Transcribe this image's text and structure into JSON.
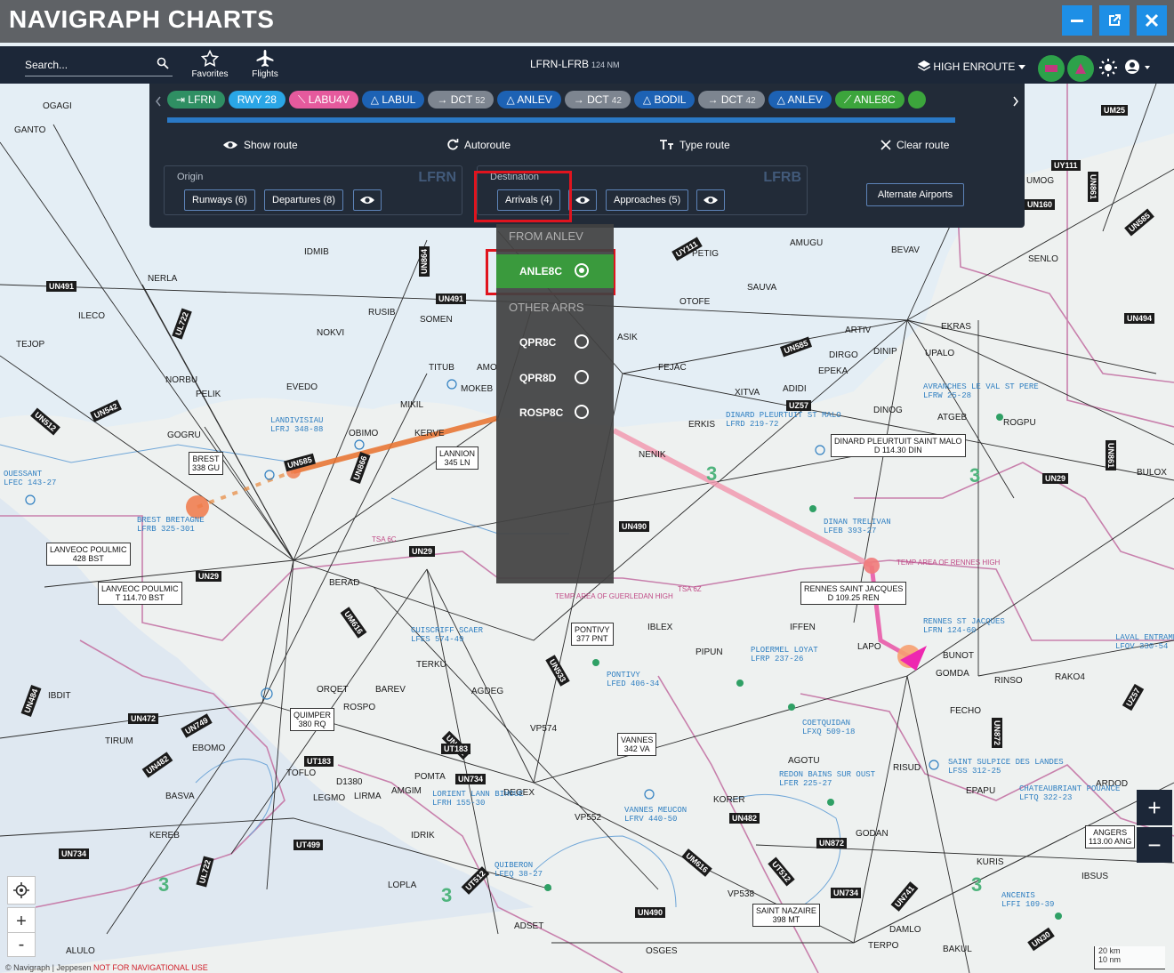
{
  "window": {
    "title": "NAVIGRAPH CHARTS",
    "controls": [
      "minimize",
      "popout",
      "close"
    ]
  },
  "toolbar": {
    "search_placeholder": "Search...",
    "favorites_label": "Favorites",
    "flights_label": "Flights",
    "route": "LFRN-LFRB",
    "distance": "124 NM",
    "layer": "HIGH ENROUTE"
  },
  "route_panel": {
    "chips": [
      {
        "label": "LFRN",
        "kind": "airport",
        "color": "#2f8f63"
      },
      {
        "label": "RWY 28",
        "kind": "runway",
        "color": "#2aa6e6"
      },
      {
        "label": "LABU4V",
        "kind": "sid",
        "color": "#e55a9d"
      },
      {
        "label": "LABUL",
        "kind": "fix",
        "color": "#1d62b4"
      },
      {
        "label": "DCT",
        "num": "52",
        "kind": "direct",
        "color": "#7d8590"
      },
      {
        "label": "ANLEV",
        "kind": "fix",
        "color": "#1d62b4"
      },
      {
        "label": "DCT",
        "num": "42",
        "kind": "direct",
        "color": "#7d8590"
      },
      {
        "label": "BODIL",
        "kind": "fix",
        "color": "#1d62b4"
      },
      {
        "label": "DCT",
        "num": "42",
        "kind": "direct",
        "color": "#7d8590"
      },
      {
        "label": "ANLEV",
        "kind": "fix",
        "color": "#1d62b4"
      },
      {
        "label": "ANLE8C",
        "kind": "star",
        "color": "#3ca53c"
      }
    ],
    "show_route": "Show route",
    "autoroute": "Autoroute",
    "type_route": "Type route",
    "clear_route": "Clear route",
    "origin": {
      "caption": "Origin",
      "icao": "LFRN",
      "runways": "Runways (6)",
      "departures": "Departures (8)"
    },
    "destination": {
      "caption": "Destination",
      "icao": "LFRB",
      "arrivals": "Arrivals (4)",
      "approaches": "Approaches (5)"
    },
    "alternate": "Alternate Airports"
  },
  "arrivals_dropdown": {
    "group_from": "FROM ANLEV",
    "selected": "ANLE8C",
    "group_other": "OTHER ARRS",
    "others": [
      "QPR8C",
      "QPR8D",
      "ROSP8C"
    ]
  },
  "map": {
    "fixes": [
      "OGAGI",
      "GANTO",
      "NERLA",
      "ILECO",
      "TEJOP",
      "IDMIB",
      "RUSIB",
      "SOMEN",
      "NOKVI",
      "NORBU",
      "PELIK",
      "EVEDO",
      "TITUB",
      "AMO",
      "MOKEB",
      "MIKIL",
      "KERVE",
      "GOGRU",
      "OBIMO",
      "PETIG",
      "SAUVA",
      "OTOFE",
      "AMUGU",
      "BEVAV",
      "SENLO",
      "ARTIV",
      "DIRGO",
      "DINIP",
      "UPALO",
      "EKRAS",
      "EPEKA",
      "XITVA",
      "ADIDI",
      "FEJAC",
      "ASIK",
      "DINOG",
      "ATGEB",
      "ROGPU",
      "ERKIS",
      "NENIK",
      "BULOX",
      "BERAD",
      "IBLEX",
      "IFFEN",
      "LAPO",
      "BUNOT",
      "GOMDA",
      "RINSO",
      "RAKO4",
      "PIPUN",
      "TERKU",
      "IBDIT",
      "ORQET",
      "BAREV",
      "AGDEG",
      "ROSPO",
      "TIRUM",
      "EBOMO",
      "VP574",
      "TOFLO",
      "D1380",
      "LEGMO",
      "LIRMA",
      "AMGIM",
      "POMTA",
      "DEGEX",
      "VP552",
      "KORER",
      "AGOTU",
      "RISUD",
      "EPAPU",
      "ARDOD",
      "FECHO",
      "BASVA",
      "KEREB",
      "IDRIK",
      "LOPLA",
      "GODAN",
      "KURIS",
      "IBSUS",
      "VP538",
      "DAMLO",
      "BAKUL",
      "TERPO",
      "ADSET",
      "OSGES",
      "ALULO",
      "UMOG"
    ],
    "airways": [
      "UN491",
      "UM25",
      "UY111",
      "UN861",
      "UN160",
      "UN585",
      "UN494",
      "UN542",
      "UN512",
      "UL722",
      "UN864",
      "UN491",
      "UY111",
      "UN585",
      "UZ57",
      "UN29",
      "UN861",
      "UN585",
      "UN866",
      "UN29",
      "UN29",
      "UN490",
      "UM616",
      "UN533",
      "UN472",
      "UN749",
      "UN482",
      "UT183",
      "UN482",
      "UN734",
      "UN734",
      "UT499",
      "UT512",
      "UN490",
      "UM616",
      "UT512",
      "UN734",
      "UN872",
      "UN741",
      "UN30",
      "UL722",
      "UN484",
      "UN872",
      "UZ57",
      "UN482",
      "UT183"
    ],
    "navaids": [
      {
        "name": "BREST",
        "freq": "338 GU"
      },
      {
        "name": "LANNION",
        "freq": "345 LN"
      },
      {
        "name": "LANVEOC POULMIC",
        "freq": "428 BST"
      },
      {
        "name": "LANVEOC POULMIC",
        "freq": "T 114.70 BST"
      },
      {
        "name": "DINARD PLEURTUIT SAINT MALO",
        "freq": "D 114.30 DIN"
      },
      {
        "name": "RENNES SAINT JACQUES",
        "freq": "D 109.25 REN"
      },
      {
        "name": "PONTIVY",
        "freq": "377 PNT"
      },
      {
        "name": "QUIMPER",
        "freq": "380 RQ"
      },
      {
        "name": "VANNES",
        "freq": "342 VA"
      },
      {
        "name": "SAINT NAZAIRE",
        "freq": "398 MT"
      },
      {
        "name": "ANGERS",
        "freq": "113.00 ANG"
      }
    ],
    "airports": [
      {
        "name": "LANDIVISIAU",
        "code": "LFRJ 348-88"
      },
      {
        "name": "BREST BRETAGNE",
        "code": "LFRB 325-301"
      },
      {
        "name": "OUESSANT",
        "code": "LFEC 143-27"
      },
      {
        "name": "DINARD PLEURTUIT ST MALO",
        "code": "LFRD 219-72"
      },
      {
        "name": "AVRANCHES LE VAL ST PERE",
        "code": "LFRW 25-28"
      },
      {
        "name": "DINAN TRELIVAN",
        "code": "LFEB 393-27"
      },
      {
        "name": "RENNES ST JACQUES",
        "code": "LFRN 124-60"
      },
      {
        "name": "PLOERMEL LOYAT",
        "code": "LFRP 237-26"
      },
      {
        "name": "PONTIVY",
        "code": "LFED 406-34"
      },
      {
        "name": "COETQUIDAN",
        "code": "LFXQ 509-18"
      },
      {
        "name": "REDON BAINS SUR OUST",
        "code": "LFER 225-27"
      },
      {
        "name": "VANNES MEUCON",
        "code": "LFRV 440-50"
      },
      {
        "name": "LORIENT LANN BIHOUE",
        "code": "LFRH 155-30"
      },
      {
        "name": "QUIBERON",
        "code": "LFEQ 38-27"
      },
      {
        "name": "SAINT SULPICE DES LANDES",
        "code": "LFSS 312-25"
      },
      {
        "name": "CHATEAUBRIANT POUANCE",
        "code": "LFTQ 322-23"
      },
      {
        "name": "ANCENIS",
        "code": "LFFI 109-39"
      },
      {
        "name": "LAVAL ENTRAMMES",
        "code": "LFOV 330-54"
      },
      {
        "name": "GUISCRIFF SCAER",
        "code": "LFES 574-49"
      }
    ],
    "areas": [
      "TSA 6C",
      "TSA 6Z",
      "TEMP AREA OF GUERLEDAN HIGH",
      "TEMP AREA OF RENNES HIGH"
    ],
    "msa_values": [
      "3",
      "3",
      "3",
      "3",
      "3",
      "3"
    ]
  },
  "credits": {
    "copyright": "© Navigraph | Jeppesen",
    "warning": "NOT FOR NAVIGATIONAL USE"
  },
  "scale": {
    "label1": "20 km",
    "label2": "10 nm"
  },
  "colors": {
    "titlebar": "#5f6266",
    "toolbar": "#1c2738",
    "panel": "#222b38",
    "accent_blue": "#1e8fe6",
    "selected_green": "#3a9a3d",
    "highlight_red": "#e0141e",
    "route_orange": "#e8702a",
    "route_pink": "#f19ab0"
  }
}
